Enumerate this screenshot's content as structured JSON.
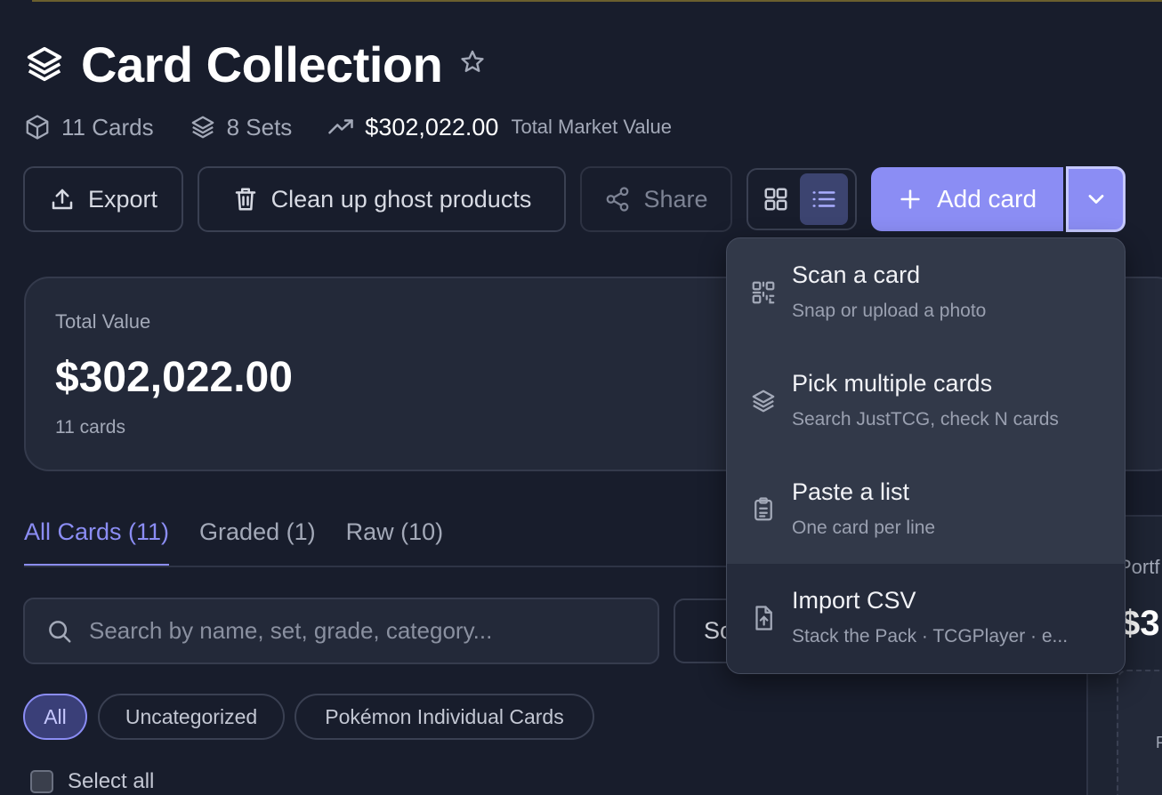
{
  "page": {
    "title": "Card Collection"
  },
  "stats": {
    "cards": "11 Cards",
    "sets": "8 Sets",
    "market_value": "$302,022.00",
    "market_value_caption": "Total Market Value"
  },
  "toolbar": {
    "export_label": "Export",
    "cleanup_label": "Clean up ghost products",
    "share_label": "Share",
    "add_label": "Add card",
    "view_mode": "list"
  },
  "summary": {
    "label": "Total Value",
    "amount": "$302,022.00",
    "count": "11 cards"
  },
  "tabs": [
    {
      "label": "All Cards (11)",
      "active": true
    },
    {
      "label": "Graded (1)",
      "active": false
    },
    {
      "label": "Raw (10)",
      "active": false
    }
  ],
  "search": {
    "placeholder": "Search by name, set, grade, category...",
    "value": ""
  },
  "sort": {
    "label": "So"
  },
  "filters": [
    {
      "label": "All",
      "active": true
    },
    {
      "label": "Uncategorized",
      "active": false
    },
    {
      "label": "Pokémon Individual Cards",
      "active": false
    }
  ],
  "select_all_label": "Select all",
  "side_card": {
    "title": "Portf",
    "amount": "$3",
    "inner_text": "P"
  },
  "dropdown": {
    "items": [
      {
        "title": "Scan a card",
        "subtitle": "Snap or upload a photo",
        "icon": "qr-scan-icon"
      },
      {
        "title": "Pick multiple cards",
        "subtitle": "Search JustTCG, check N cards",
        "icon": "layers-icon"
      },
      {
        "title": "Paste a list",
        "subtitle": "One card per line",
        "icon": "clipboard-list-icon"
      },
      {
        "title": "Import CSV",
        "subtitle": "Stack the Pack · TCGPlayer · e...",
        "icon": "file-upload-icon"
      }
    ]
  },
  "colors": {
    "background": "#181d2c",
    "accent": "#8b8df4",
    "card": "#232939",
    "dropdown": "#323949"
  }
}
